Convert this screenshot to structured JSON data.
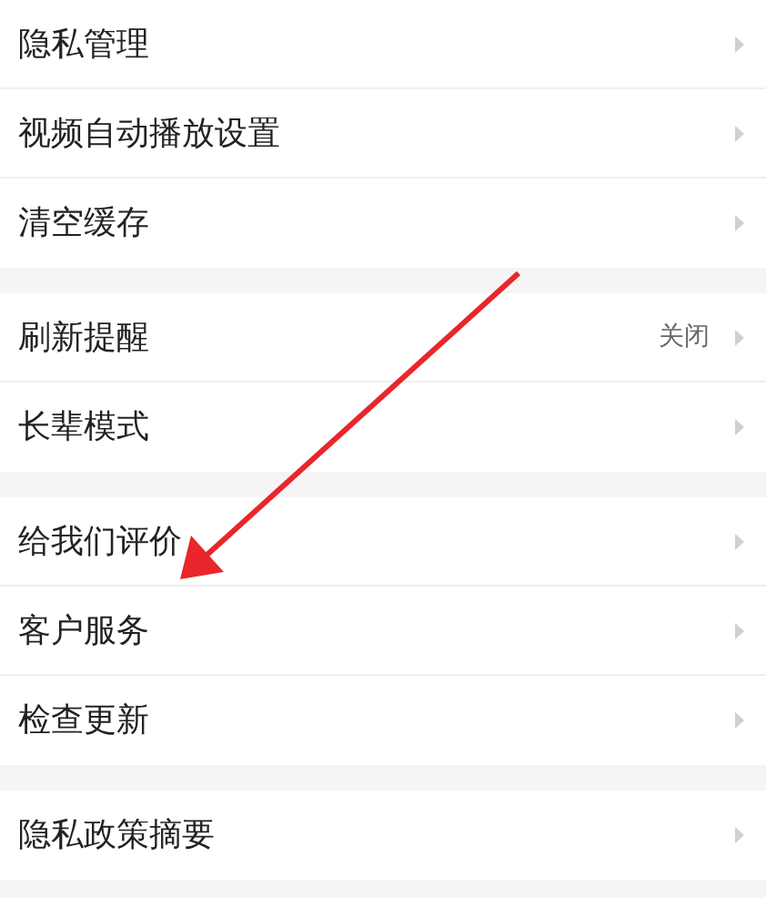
{
  "groups": [
    {
      "items": [
        {
          "label": "隐私管理"
        },
        {
          "label": "视频自动播放设置"
        },
        {
          "label": "清空缓存"
        }
      ]
    },
    {
      "items": [
        {
          "label": "刷新提醒",
          "value": "关闭"
        },
        {
          "label": "长辈模式"
        }
      ]
    },
    {
      "items": [
        {
          "label": "给我们评价"
        },
        {
          "label": "客户服务"
        },
        {
          "label": "检查更新"
        }
      ]
    },
    {
      "items": [
        {
          "label": "隐私政策摘要"
        }
      ]
    }
  ],
  "annotations": [
    {
      "kind": "arrow"
    }
  ]
}
